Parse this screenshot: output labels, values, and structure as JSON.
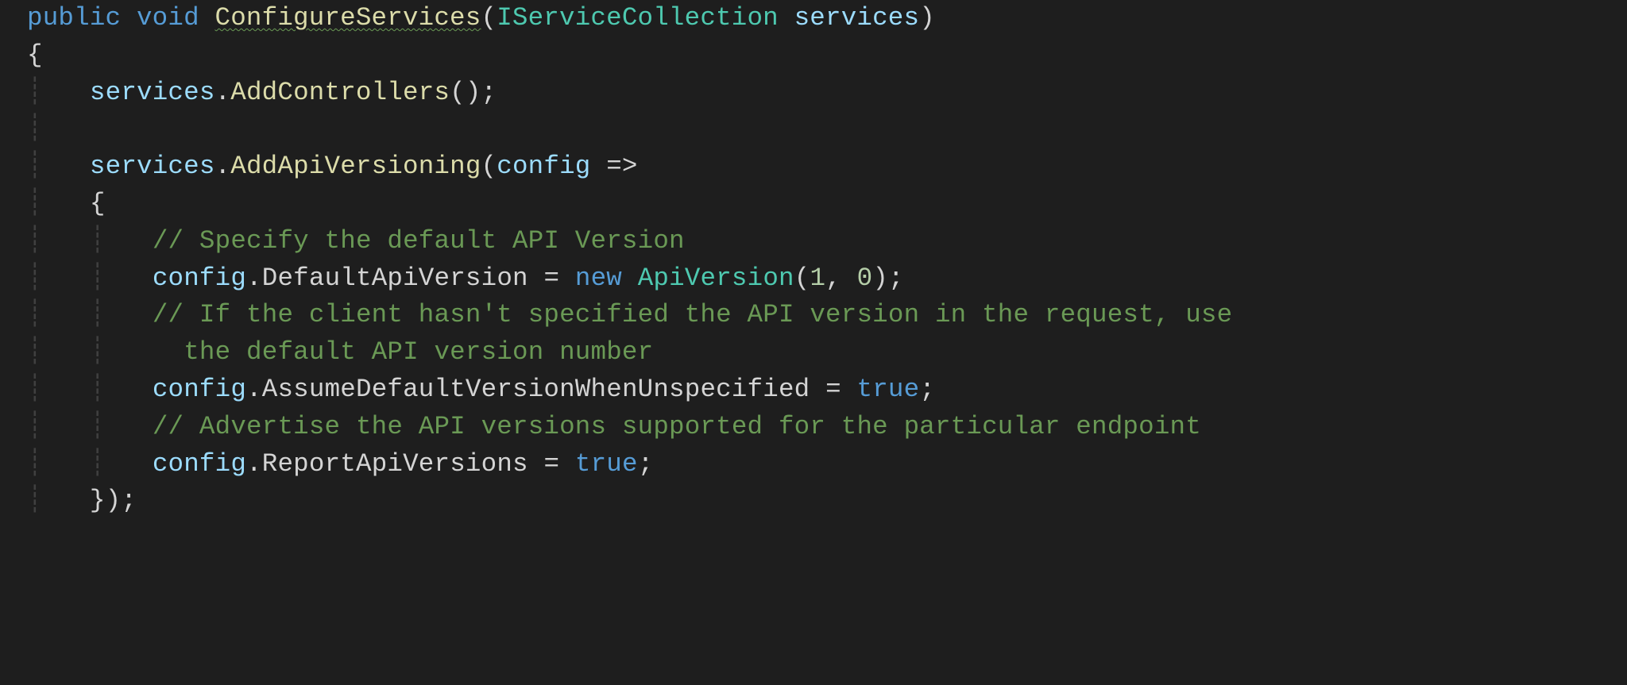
{
  "code": {
    "l1": {
      "kw_public": "public",
      "kw_void": "void",
      "method": "ConfigureServices",
      "p_open": "(",
      "type_isc": "IServiceCollection",
      "param_services": "services",
      "p_close": ")"
    },
    "l2": {
      "brace": "{"
    },
    "l3": {
      "obj": "services",
      "dot": ".",
      "method": "AddControllers",
      "call": "();"
    },
    "l5": {
      "obj": "services",
      "dot": ".",
      "method": "AddApiVersioning",
      "p_open": "(",
      "param": "config",
      "arrow": " =>"
    },
    "l6": {
      "brace": "{"
    },
    "l7": {
      "comment": "// Specify the default API Version"
    },
    "l8": {
      "obj": "config",
      "dot": ".",
      "prop": "DefaultApiVersion",
      "eq": " = ",
      "kw_new": "new",
      "type": "ApiVersion",
      "p_open": "(",
      "n1": "1",
      "comma": ", ",
      "n2": "0",
      "p_close": ");"
    },
    "l9": {
      "comment": "// If the client hasn't specified the API version in the request, use "
    },
    "l10": {
      "comment": "the default API version number"
    },
    "l11": {
      "obj": "config",
      "dot": ".",
      "prop": "AssumeDefaultVersionWhenUnspecified",
      "eq": " = ",
      "kw_true": "true",
      "semi": ";"
    },
    "l12": {
      "comment": "// Advertise the API versions supported for the particular endpoint"
    },
    "l13": {
      "obj": "config",
      "dot": ".",
      "prop": "ReportApiVersions",
      "eq": " = ",
      "kw_true": "true",
      "semi": ";"
    },
    "l14": {
      "close": "});"
    }
  }
}
